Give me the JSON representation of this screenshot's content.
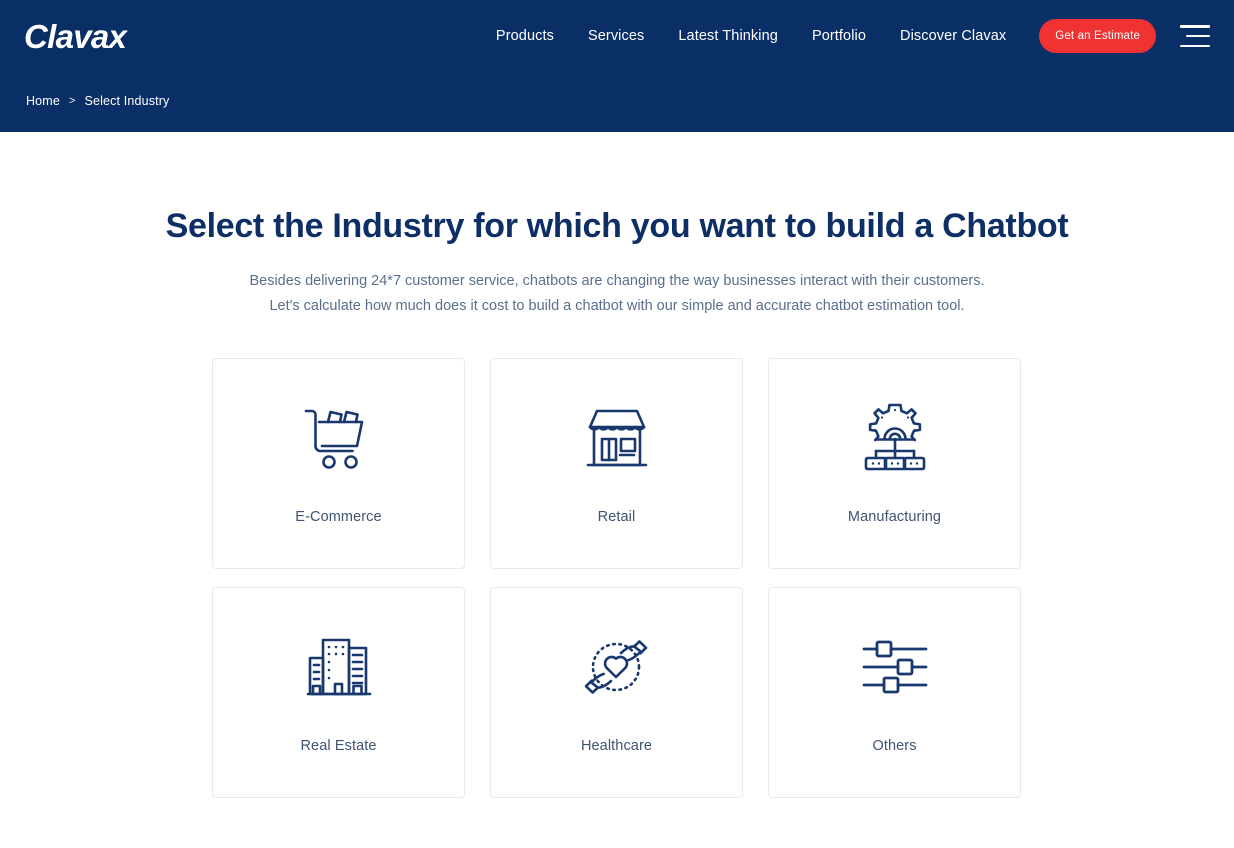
{
  "header": {
    "logo": "Clavax",
    "brand_navy": "#0a2f66",
    "cta_red": "#f03232",
    "nav": [
      {
        "label": "Products",
        "name": "nav-products"
      },
      {
        "label": "Services",
        "name": "nav-services"
      },
      {
        "label": "Latest Thinking",
        "name": "nav-latest-thinking"
      },
      {
        "label": "Portfolio",
        "name": "nav-portfolio"
      },
      {
        "label": "Discover Clavax",
        "name": "nav-discover-clavax"
      }
    ],
    "cta_label": "Get an Estimate",
    "menu_icon": "hamburger-menu-icon"
  },
  "breadcrumb": {
    "home": "Home",
    "separator": ">",
    "current": "Select Industry"
  },
  "main": {
    "title": "Select the Industry for which you want to build a Chatbot",
    "subtitle_line1": "Besides delivering 24*7 customer service, chatbots are changing the way businesses interact with their customers.",
    "subtitle_line2": "Let's calculate how much does it cost to build a chatbot with our simple and accurate chatbot estimation tool.",
    "title_color": "#0e2f66",
    "subtitle_color": "#5a6f8c",
    "cards": [
      {
        "label": "E-Commerce",
        "icon": "shopping-cart-icon"
      },
      {
        "label": "Retail",
        "icon": "storefront-icon"
      },
      {
        "label": "Manufacturing",
        "icon": "gear-network-icon"
      },
      {
        "label": "Real Estate",
        "icon": "buildings-icon"
      },
      {
        "label": "Healthcare",
        "icon": "hands-heart-icon"
      },
      {
        "label": "Others",
        "icon": "sliders-icon"
      }
    ]
  }
}
